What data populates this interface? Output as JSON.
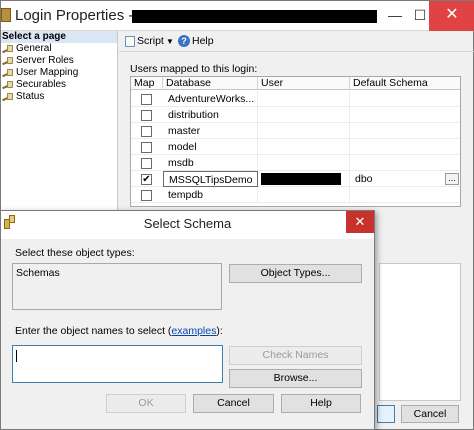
{
  "login_properties": {
    "title": "Login Properties -",
    "window_controls": {
      "minimize": "—",
      "maximize": "☐",
      "close": "✕"
    },
    "left_panel": {
      "header": "Select a page",
      "pages": [
        {
          "label": "General"
        },
        {
          "label": "Server Roles"
        },
        {
          "label": "User Mapping"
        },
        {
          "label": "Securables"
        },
        {
          "label": "Status"
        }
      ]
    },
    "toolbar": {
      "script_label": "Script",
      "script_arrow": "▼",
      "help_label": "Help",
      "help_glyph": "?"
    },
    "mapped_label": "Users mapped to this login:",
    "grid": {
      "columns": [
        "Map",
        "Database",
        "User",
        "Default Schema"
      ],
      "rows": [
        {
          "checked": "",
          "database": "AdventureWorks...",
          "schema": ""
        },
        {
          "checked": "",
          "database": "distribution",
          "schema": ""
        },
        {
          "checked": "",
          "database": "master",
          "schema": ""
        },
        {
          "checked": "",
          "database": "model",
          "schema": ""
        },
        {
          "checked": "",
          "database": "msdb",
          "schema": ""
        },
        {
          "checked": "✔",
          "database": "MSSQLTipsDemo",
          "schema": "dbo",
          "ellipsis": "..."
        },
        {
          "checked": "",
          "database": "tempdb",
          "schema": ""
        }
      ]
    },
    "cancel_label": "Cancel"
  },
  "select_schema": {
    "title": "Select Schema",
    "close_glyph": "✕",
    "object_types_label": "Select these object types:",
    "object_types_value": "Schemas",
    "object_types_button": "Object Types...",
    "names_label_prefix": "Enter the object names to select (",
    "names_label_link": "examples",
    "names_label_suffix": "):",
    "names_input_value": "",
    "check_names_button": "Check Names",
    "browse_button": "Browse...",
    "ok_button": "OK",
    "cancel_button": "Cancel",
    "help_button": "Help"
  },
  "colors": {
    "close_red": "#e04343",
    "selection_blue": "#dbe6f4",
    "link_blue": "#0645ad"
  }
}
